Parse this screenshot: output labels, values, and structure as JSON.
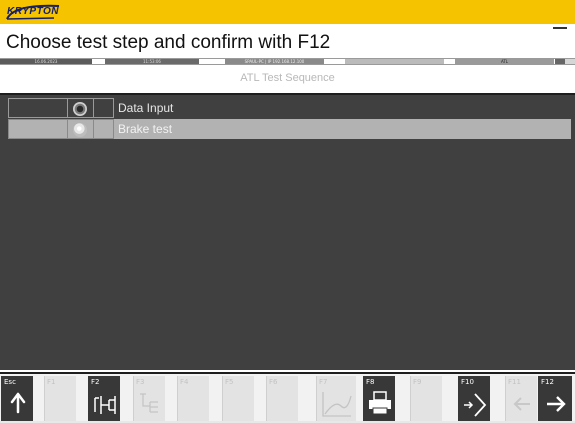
{
  "header": {
    "logo_text": "KRYPTON",
    "instruction": "Choose test step and confirm with F12"
  },
  "status_strip": {
    "cells": [
      "16.06.2023",
      "11:53:06",
      "SPAUL-PC | IP 192.168.12.100",
      "",
      "",
      "ATL"
    ]
  },
  "section": {
    "title": "ATL Test Sequence"
  },
  "steps": [
    {
      "label": "Data Input",
      "selected": false
    },
    {
      "label": "Brake test",
      "selected": true
    }
  ],
  "function_keys": [
    {
      "key": "Esc",
      "icon": "arrow-up-icon",
      "active": true
    },
    {
      "key": "F1",
      "icon": "",
      "active": false
    },
    {
      "key": "F2",
      "icon": "tree-branch-icon",
      "active": true
    },
    {
      "key": "F3",
      "icon": "hierarchy-icon",
      "active": false
    },
    {
      "key": "F4",
      "icon": "",
      "active": false
    },
    {
      "key": "F5",
      "icon": "",
      "active": false
    },
    {
      "key": "F6",
      "icon": "",
      "active": false
    },
    {
      "key": "F7",
      "icon": "graph-icon",
      "active": false
    },
    {
      "key": "F8",
      "icon": "printer-icon",
      "active": true
    },
    {
      "key": "F9",
      "icon": "",
      "active": false
    },
    {
      "key": "F10",
      "icon": "confirm-arrow-icon",
      "active": true
    },
    {
      "key": "F11",
      "icon": "arrow-left-icon",
      "active": false
    },
    {
      "key": "F12",
      "icon": "arrow-right-icon",
      "active": true
    }
  ],
  "colors": {
    "brand_yellow": "#f6c300",
    "brand_blue": "#14206b",
    "panel_background": "#404040",
    "selected_row": "#b2b2b2",
    "active_key": "#383838"
  }
}
